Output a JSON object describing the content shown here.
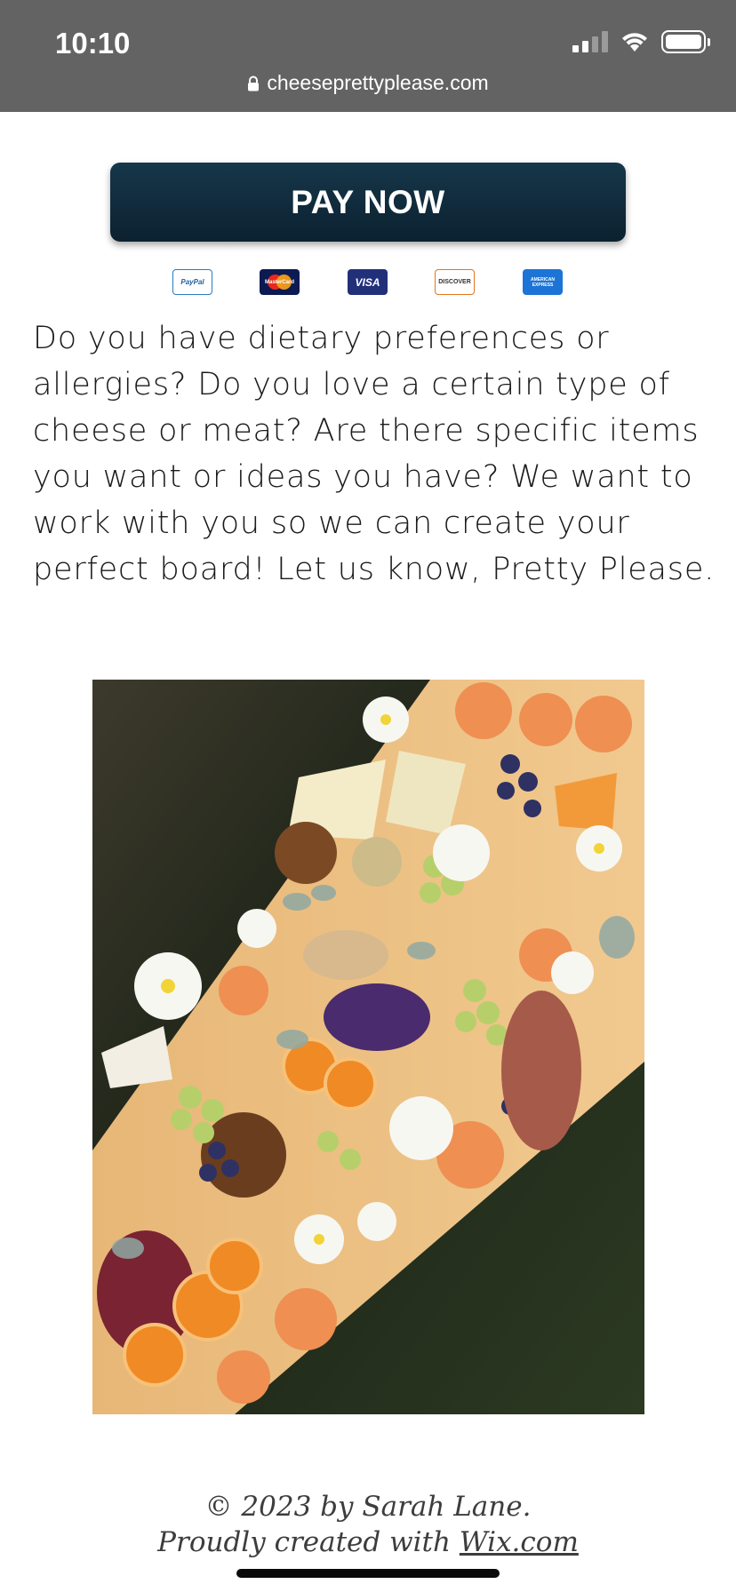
{
  "status_bar": {
    "time": "10:10",
    "url": "cheeseprettyplease.com"
  },
  "payment": {
    "pay_now_label": "PAY NOW",
    "methods": [
      {
        "label": "PayPal",
        "icon": "paypal-icon"
      },
      {
        "label": "MasterCard",
        "icon": "mastercard-icon"
      },
      {
        "label": "VISA",
        "icon": "visa-icon"
      },
      {
        "label": "DISCOVER",
        "icon": "discover-icon"
      },
      {
        "label": "AMERICAN EXPRESS",
        "icon": "amex-icon"
      }
    ]
  },
  "content": {
    "intro_text": "Do you have dietary preferences or allergies? Do you love a certain type of cheese or meat? Are there specific items you want or ideas you have? We want to work with you so we can create your perfect board! Let us know, Pretty Please."
  },
  "footer": {
    "copyright": "© 2023 by Sarah Lane.",
    "created_with": "Proudly created with",
    "link_text": "Wix.com"
  }
}
